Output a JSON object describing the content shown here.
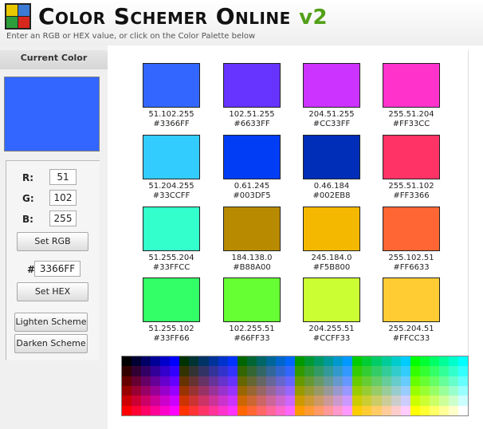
{
  "app": {
    "title_text": "Color Schemer Online",
    "version": "v2",
    "subtitle": "Enter an RGB or HEX value, or click on the Color Palette below"
  },
  "left_panel": {
    "heading": "Current Color",
    "current_color": "#3366FF",
    "labels": {
      "r": "R:",
      "g": "G:",
      "b": "B:",
      "hash": "#"
    },
    "values": {
      "r": "51",
      "g": "102",
      "b": "255",
      "hex": "3366FF"
    },
    "buttons": {
      "set_rgb": "Set RGB",
      "set_hex": "Set HEX",
      "lighten": "Lighten Scheme",
      "darken": "Darken Scheme"
    }
  },
  "scheme": [
    {
      "rgb": "51.102.255",
      "hex": "#3366FF",
      "color": "#3366FF"
    },
    {
      "rgb": "102.51.255",
      "hex": "#6633FF",
      "color": "#6633FF"
    },
    {
      "rgb": "204.51.255",
      "hex": "#CC33FF",
      "color": "#CC33FF"
    },
    {
      "rgb": "255.51.204",
      "hex": "#FF33CC",
      "color": "#FF33CC"
    },
    {
      "rgb": "51.204.255",
      "hex": "#33CCFF",
      "color": "#33CCFF"
    },
    {
      "rgb": "0.61.245",
      "hex": "#003DF5",
      "color": "#003DF5"
    },
    {
      "rgb": "0.46.184",
      "hex": "#002EB8",
      "color": "#002EB8"
    },
    {
      "rgb": "255.51.102",
      "hex": "#FF3366",
      "color": "#FF3366"
    },
    {
      "rgb": "51.255.204",
      "hex": "#33FFCC",
      "color": "#33FFCC"
    },
    {
      "rgb": "184.138.0",
      "hex": "#B88A00",
      "color": "#B88A00"
    },
    {
      "rgb": "245.184.0",
      "hex": "#F5B800",
      "color": "#F5B800"
    },
    {
      "rgb": "255.102.51",
      "hex": "#FF6633",
      "color": "#FF6633"
    },
    {
      "rgb": "51.255.102",
      "hex": "#33FF66",
      "color": "#33FF66"
    },
    {
      "rgb": "102.255.51",
      "hex": "#66FF33",
      "color": "#66FF33"
    },
    {
      "rgb": "204.255.51",
      "hex": "#CCFF33",
      "color": "#CCFF33"
    },
    {
      "rgb": "255.204.51",
      "hex": "#FFCC33",
      "color": "#FFCC33"
    }
  ]
}
